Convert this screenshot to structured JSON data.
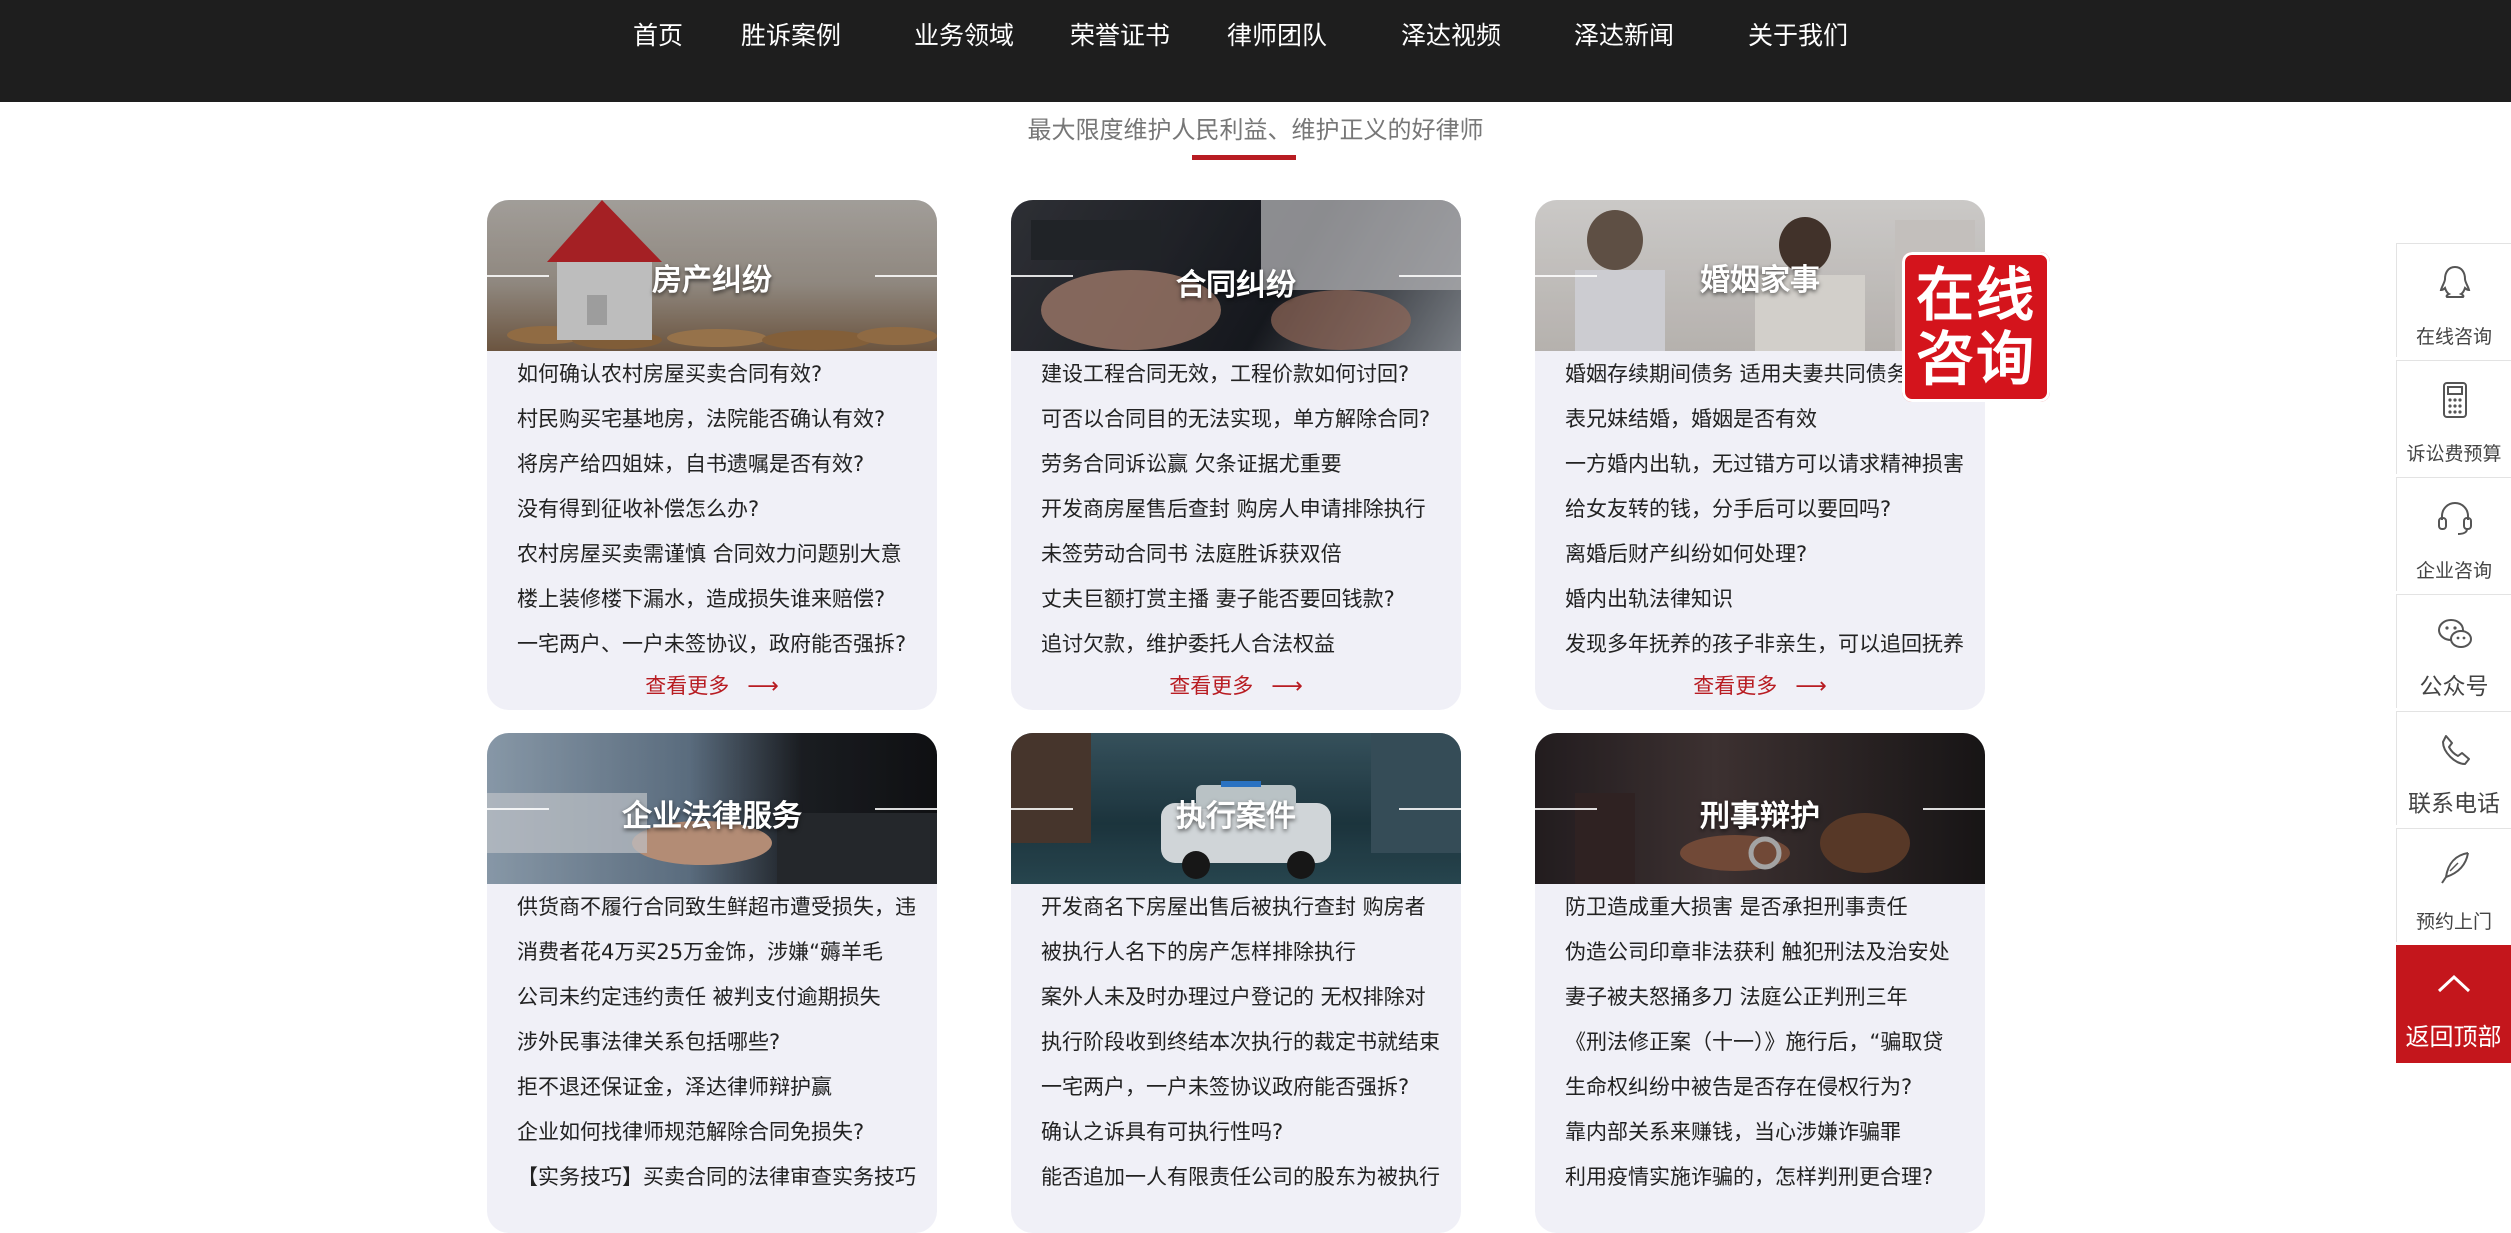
{
  "nav": {
    "items": [
      "首页",
      "胜诉案例",
      "业务领域",
      "荣誉证书",
      "律师团队",
      "泽达视频",
      "泽达新闻",
      "关于我们"
    ]
  },
  "slogan": "最大限度维护人民利益、维护正义的好律师",
  "cards": [
    {
      "title": "房产纠纷",
      "items": [
        "如何确认农村房屋买卖合同有效?",
        "村民购买宅基地房，法院能否确认有效?",
        "将房产给四姐妹，自书遗嘱是否有效?",
        "没有得到征收补偿怎么办?",
        "农村房屋买卖需谨慎 合同效力问题别大意",
        "楼上装修楼下漏水，造成损失谁来赔偿?",
        "一宅两户、一户未签协议，政府能否强拆?"
      ],
      "more": "查看更多"
    },
    {
      "title": "合同纠纷",
      "items": [
        "建设工程合同无效，工程价款如何讨回?",
        "可否以合同目的无法实现，单方解除合同?",
        "劳务合同诉讼赢 欠条证据尤重要",
        "开发商房屋售后查封 购房人申请排除执行",
        "未签劳动合同书 法庭胜诉获双倍",
        "丈夫巨额打赏主播 妻子能否要回钱款?",
        "追讨欠款，维护委托人合法权益"
      ],
      "more": "查看更多"
    },
    {
      "title": "婚姻家事",
      "items": [
        "婚姻存续期间债务 适用夫妻共同债务",
        "表兄妹结婚，婚姻是否有效",
        "一方婚内出轨，无过错方可以请求精神损害",
        "给女友转的钱，分手后可以要回吗?",
        "离婚后财产纠纷如何处理?",
        "婚内出轨法律知识",
        "发现多年抚养的孩子非亲生，可以追回抚养"
      ],
      "more": "查看更多"
    },
    {
      "title": "企业法律服务",
      "items": [
        "供货商不履行合同致生鲜超市遭受损失，违",
        "消费者花4万买25万金饰，涉嫌“薅羊毛",
        "公司未约定违约责任 被判支付逾期损失",
        "涉外民事法律关系包括哪些?",
        "拒不退还保证金，泽达律师辩护赢",
        "企业如何找律师规范解除合同免损失?",
        "【实务技巧】买卖合同的法律审查实务技巧"
      ]
    },
    {
      "title": "执行案件",
      "items": [
        "开发商名下房屋出售后被执行查封 购房者",
        "被执行人名下的房产怎样排除执行",
        "案外人未及时办理过户登记的 无权排除对",
        "执行阶段收到终结本次执行的裁定书就结束",
        "一宅两户，一户未签协议政府能否强拆?",
        "确认之诉具有可执行性吗?",
        "能否追加一人有限责任公司的股东为被执行"
      ]
    },
    {
      "title": "刑事辩护",
      "items": [
        "防卫造成重大损害 是否承担刑事责任",
        "伪造公司印章非法获利 触犯刑法及治安处",
        "妻子被夫怒捅多刀 法庭公正判刑三年",
        "《刑法修正案（十一）》施行后，“骗取贷",
        "生命权纠纷中被告是否存在侵权行为?",
        "靠内部关系来赚钱，当心涉嫌诈骗罪",
        "利用疫情实施诈骗的，怎样判刑更合理?"
      ]
    }
  ],
  "consult_badge": [
    "在线",
    "咨询"
  ],
  "sidebar": {
    "items": [
      {
        "label": "在线咨询",
        "icon": "qq-icon"
      },
      {
        "label": "诉讼费预算",
        "icon": "calculator-icon"
      },
      {
        "label": "企业咨询",
        "icon": "headset-icon"
      },
      {
        "label": "公众号",
        "icon": "wechat-icon"
      },
      {
        "label": "联系电话",
        "icon": "phone-icon"
      },
      {
        "label": "预约上门",
        "icon": "feather-icon"
      }
    ],
    "back_to_top": "返回顶部"
  },
  "colors": {
    "nav_bg": "#1e1e1e",
    "accent": "#b81c22",
    "card_bg": "#f0f0f7",
    "badge": "#d4141c"
  }
}
